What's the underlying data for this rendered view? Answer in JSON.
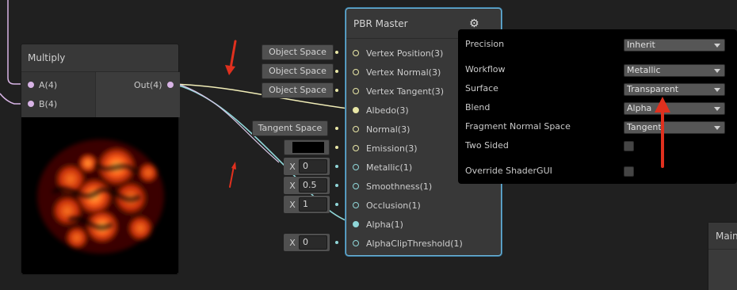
{
  "multiply": {
    "title": "Multiply",
    "inputs": [
      {
        "label": "A(4)"
      },
      {
        "label": "B(4)"
      }
    ],
    "output": "Out(4)",
    "preview": "noise-texture-preview"
  },
  "pbr": {
    "title": "PBR Master",
    "slots": [
      {
        "label": "Vertex Position(3)"
      },
      {
        "label": "Vertex Normal(3)"
      },
      {
        "label": "Vertex Tangent(3)"
      },
      {
        "label": "Albedo(3)"
      },
      {
        "label": "Normal(3)"
      },
      {
        "label": "Emission(3)"
      },
      {
        "label": "Metallic(1)"
      },
      {
        "label": "Smoothness(1)"
      },
      {
        "label": "Occlusion(1)"
      },
      {
        "label": "Alpha(1)"
      },
      {
        "label": "AlphaClipThreshold(1)"
      }
    ],
    "space_inputs": [
      "Object Space",
      "Object Space",
      "Object Space",
      "Tangent Space"
    ],
    "vec1_inputs": [
      {
        "axis": "X",
        "value": "0"
      },
      {
        "axis": "X",
        "value": "0.5"
      },
      {
        "axis": "X",
        "value": "1"
      },
      {
        "axis": "X",
        "value": "0"
      }
    ],
    "emission_color": "#000000"
  },
  "settings": {
    "precision_label": "Precision",
    "precision_value": "Inherit",
    "workflow_label": "Workflow",
    "workflow_value": "Metallic",
    "surface_label": "Surface",
    "surface_value": "Transparent",
    "blend_label": "Blend",
    "blend_value": "Alpha",
    "fns_label": "Fragment Normal Space",
    "fns_value": "Tangent",
    "two_sided_label": "Two Sided",
    "two_sided_checked": false,
    "override_label": "Override ShaderGUI",
    "override_checked": false
  },
  "main_node": {
    "title": "Main"
  },
  "colors": {
    "vec3_port": "#e8e6a6",
    "vec1_port": "#8fd6d8",
    "vec4_port": "#d8b4e6",
    "selection_outline": "#6fb4d8",
    "annotation_arrow": "#e0301e"
  }
}
